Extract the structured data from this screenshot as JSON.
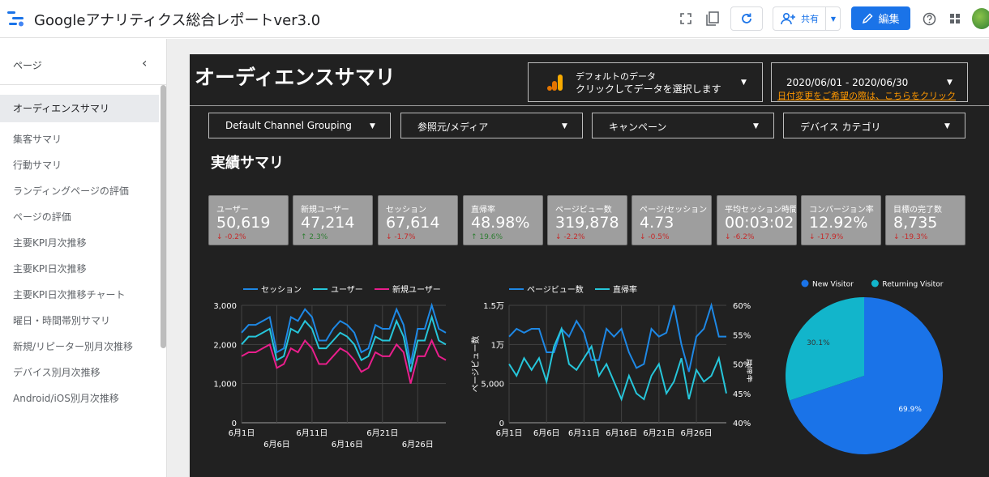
{
  "app": {
    "title": "Googleアナリティクス総合レポートver3.0"
  },
  "toolbar": {
    "share_label": "共有",
    "edit_label": "編集"
  },
  "sidebar": {
    "header": "ページ",
    "items": [
      {
        "label": "オーディエンスサマリ",
        "active": true
      },
      {
        "label": "集客サマリ"
      },
      {
        "label": "行動サマリ"
      },
      {
        "label": "ランディングページの評価"
      },
      {
        "label": "ページの評価"
      },
      {
        "label": "主要KPI月次推移"
      },
      {
        "label": "主要KPI日次推移"
      },
      {
        "label": "主要KPI日次推移チャート"
      },
      {
        "label": "曜日・時間帯別サマリ"
      },
      {
        "label": "新規/リピーター別月次推移"
      },
      {
        "label": "デバイス別月次推移"
      },
      {
        "label": "Android/iOS別月次推移"
      }
    ]
  },
  "report": {
    "title": "オーディエンスサマリ",
    "datasource": {
      "line1": "デフォルトのデータ",
      "line2": "クリックしてデータを選択します"
    },
    "daterange": {
      "value": "2020/06/01 - 2020/06/30",
      "link": "日付変更をご希望の際は、こちらをクリック"
    },
    "filters": [
      "Default Channel Grouping",
      "参照元/メディア",
      "キャンペーン",
      "デバイス カテゴリ"
    ],
    "section_title": "実績サマリ",
    "kpis": [
      {
        "label": "ユーザー",
        "value": "50,619",
        "delta": "-0.2%",
        "dir": "down"
      },
      {
        "label": "新規ユーザー",
        "value": "47,214",
        "delta": "2.3%",
        "dir": "up"
      },
      {
        "label": "セッション",
        "value": "67,614",
        "delta": "-1.7%",
        "dir": "down"
      },
      {
        "label": "直帰率",
        "value": "48.98%",
        "delta": "19.6%",
        "dir": "up"
      },
      {
        "label": "ページビュー数",
        "value": "319,878",
        "delta": "-2.2%",
        "dir": "down"
      },
      {
        "label": "ページ/セッション",
        "value": "4.73",
        "delta": "-0.5%",
        "dir": "down"
      },
      {
        "label": "平均セッション時間",
        "value": "00:03:02",
        "delta": "-6.2%",
        "dir": "down"
      },
      {
        "label": "コンバージョン率",
        "value": "12.92%",
        "delta": "-17.9%",
        "dir": "down"
      },
      {
        "label": "目標の完了数",
        "value": "8,735",
        "delta": "-19.3%",
        "dir": "down"
      }
    ]
  },
  "colors": {
    "accent": "#1a73e8",
    "series_blue": "#1e88e5",
    "series_teal": "#26c6da",
    "series_magenta": "#e91e8c",
    "pie_new": "#1a73e8",
    "pie_returning": "#12b5cb",
    "delta_down": "#c62828",
    "delta_up": "#2e7d32"
  },
  "chart_data": [
    {
      "type": "line",
      "x_ticks_top": [
        "6月1日",
        "6月11日",
        "6月21日"
      ],
      "x_ticks_bottom": [
        "6月6日",
        "6月16日",
        "6月26日"
      ],
      "ylim": [
        0,
        3000
      ],
      "y_ticks": [
        "0",
        "1,000",
        "2,000",
        "3,000"
      ],
      "grid": true,
      "legend": "top",
      "series": [
        {
          "name": "セッション",
          "color": "#1e88e5",
          "values": [
            2300,
            2500,
            2500,
            2600,
            2700,
            1800,
            1900,
            2700,
            2600,
            2900,
            2700,
            2100,
            2100,
            2400,
            2600,
            2500,
            2300,
            1800,
            1900,
            2500,
            2400,
            2400,
            2900,
            2500,
            1500,
            2400,
            2400,
            3000,
            2400,
            2300
          ]
        },
        {
          "name": "ユーザー",
          "color": "#26c6da",
          "values": [
            2000,
            2200,
            2200,
            2300,
            2400,
            1600,
            1700,
            2400,
            2300,
            2600,
            2400,
            1900,
            1900,
            2100,
            2300,
            2200,
            2000,
            1600,
            1700,
            2200,
            2100,
            2100,
            2600,
            2200,
            1300,
            2100,
            2100,
            2700,
            2100,
            2000
          ]
        },
        {
          "name": "新規ユーザー",
          "color": "#e91e8c",
          "values": [
            1700,
            1800,
            1800,
            1900,
            2000,
            1400,
            1500,
            1900,
            1800,
            2100,
            1900,
            1500,
            1500,
            1700,
            1900,
            1800,
            1600,
            1300,
            1400,
            1800,
            1700,
            1700,
            2000,
            1800,
            1000,
            1700,
            1700,
            2100,
            1700,
            1600
          ]
        }
      ]
    },
    {
      "type": "line",
      "x_ticks": [
        "6月1日",
        "6月6日",
        "6月11日",
        "6月16日",
        "6月21日",
        "6月26日"
      ],
      "ylim": [
        0,
        15000
      ],
      "y_ticks": [
        "0",
        "5,000",
        "1万",
        "1.5万"
      ],
      "ylabel": "ページビュー数",
      "y2lim": [
        40,
        60
      ],
      "y2_ticks": [
        "40%",
        "45%",
        "50%",
        "55%",
        "60%"
      ],
      "y2label": "直帰率",
      "grid": true,
      "legend": "top",
      "series": [
        {
          "name": "ページビュー数",
          "color": "#1e88e5",
          "axis": "left",
          "values": [
            11000,
            12000,
            11500,
            12000,
            12000,
            9000,
            9000,
            12000,
            11000,
            13000,
            11500,
            8000,
            8000,
            12000,
            11000,
            12000,
            9000,
            7000,
            7500,
            12000,
            11000,
            11500,
            15000,
            10000,
            6500,
            11000,
            12000,
            15000,
            11000,
            11000
          ]
        },
        {
          "name": "直帰率",
          "color": "#26c6da",
          "axis": "right",
          "values": [
            50,
            48,
            51,
            49,
            51,
            47,
            53,
            56,
            50,
            49,
            51,
            53,
            48,
            50,
            47,
            44,
            48,
            45,
            44,
            48,
            50,
            45,
            47,
            51,
            44,
            49,
            47,
            48,
            51,
            45
          ]
        }
      ]
    },
    {
      "type": "pie",
      "legend": "top",
      "series": [
        {
          "name": "New Visitor",
          "value": 69.9,
          "label": "69.9%",
          "color": "#1a73e8"
        },
        {
          "name": "Returning Visitor",
          "value": 30.1,
          "label": "30.1%",
          "color": "#12b5cb"
        }
      ]
    }
  ]
}
